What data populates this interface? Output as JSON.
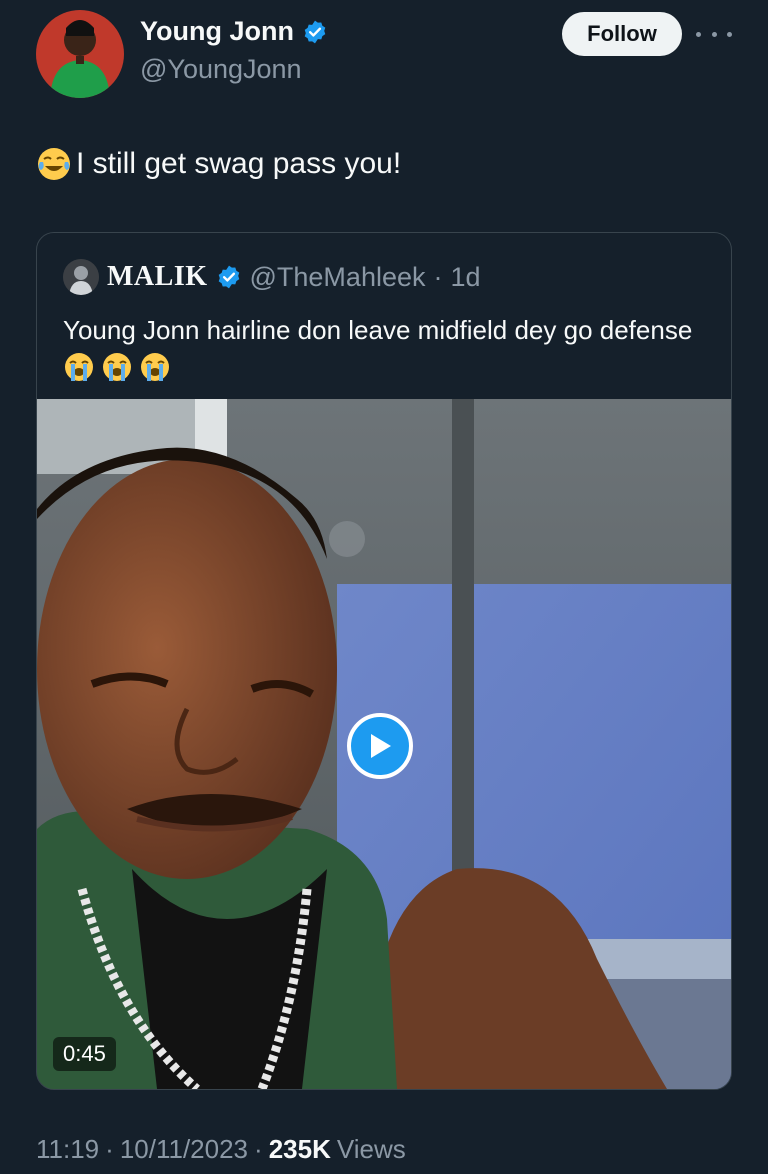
{
  "author": {
    "name": "Young Jonn",
    "handle": "@YoungJonn",
    "verified": true
  },
  "follow_label": "Follow",
  "tweet": {
    "emoji": "face-with-tears-of-joy",
    "text": "I still get swag pass you!"
  },
  "quoted_tweet": {
    "name": "MALIK",
    "handle": "@TheMahleek",
    "separator": "·",
    "time": "1d",
    "text": "Young Jonn hairline don leave midfield dey go defense",
    "emojis": [
      "loudly-crying-face",
      "loudly-crying-face",
      "loudly-crying-face"
    ],
    "video_duration": "0:45"
  },
  "meta": {
    "time": "11:19",
    "date": "10/11/2023",
    "views_count": "235K",
    "views_label": "Views",
    "separator": "·"
  },
  "colors": {
    "background": "#15202b",
    "accent": "#1d9bf0",
    "secondary_text": "#8b98a5"
  }
}
